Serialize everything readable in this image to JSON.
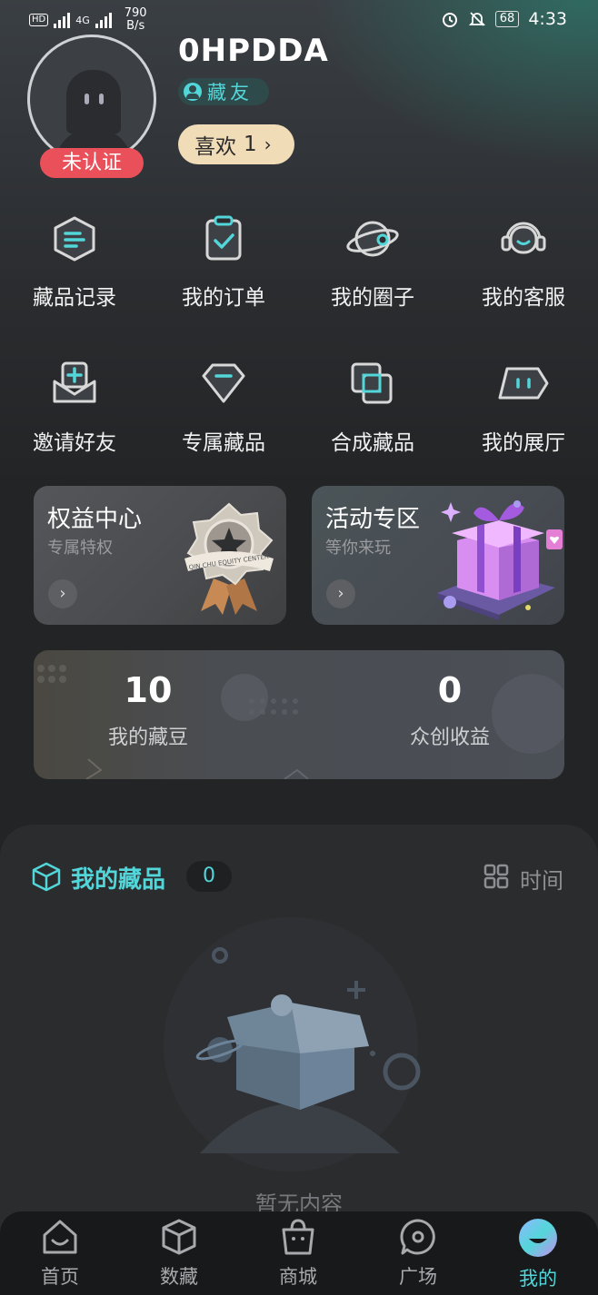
{
  "status_bar": {
    "hd": "HD",
    "network": "4G",
    "speed_value": "790",
    "speed_unit": "B/s",
    "battery": "68",
    "time": "4:33"
  },
  "profile": {
    "username": "0HPDDA",
    "verify_badge": "未认证",
    "role": "藏友",
    "likes_label": "喜欢",
    "likes_count": "1"
  },
  "menu": [
    {
      "label": "藏品记录",
      "icon": "collection-record-icon"
    },
    {
      "label": "我的订单",
      "icon": "order-clipboard-icon"
    },
    {
      "label": "我的圈子",
      "icon": "planet-circle-icon"
    },
    {
      "label": "我的客服",
      "icon": "headset-icon"
    },
    {
      "label": "邀请好友",
      "icon": "invite-inbox-icon"
    },
    {
      "label": "专属藏品",
      "icon": "diamond-icon"
    },
    {
      "label": "合成藏品",
      "icon": "layers-icon"
    },
    {
      "label": "我的展厅",
      "icon": "gallery-face-icon"
    }
  ],
  "promos": {
    "equity": {
      "title": "权益中心",
      "subtitle": "专属特权",
      "medal_text": "QIN CHU EQUITY CENTER"
    },
    "activity": {
      "title": "活动专区",
      "subtitle": "等你来玩"
    }
  },
  "stats": {
    "beans_value": "10",
    "beans_label": "我的藏豆",
    "earnings_value": "0",
    "earnings_label": "众创收益"
  },
  "collections": {
    "title": "我的藏品",
    "count": "0",
    "sort_label": "时间",
    "empty_text": "暂无内容"
  },
  "tabbar": [
    {
      "label": "首页",
      "icon": "home-icon",
      "active": false
    },
    {
      "label": "数藏",
      "icon": "cube-icon",
      "active": false
    },
    {
      "label": "商城",
      "icon": "shopping-bag-icon",
      "active": false
    },
    {
      "label": "广场",
      "icon": "chat-bubble-icon",
      "active": false
    },
    {
      "label": "我的",
      "icon": "profile-face-icon",
      "active": true
    }
  ],
  "colors": {
    "accent": "#53d6d9",
    "badge_red": "#e9505a",
    "likes_pill": "#f1dcb8",
    "background": "#232426"
  }
}
